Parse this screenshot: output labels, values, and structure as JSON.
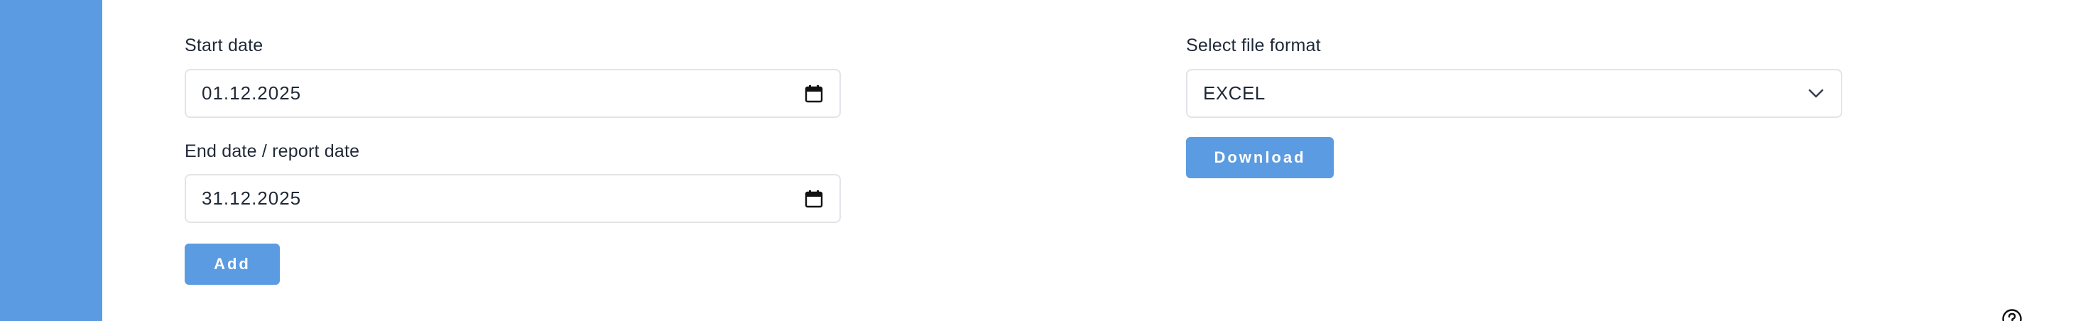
{
  "colors": {
    "sidebar": "#5b9be2",
    "primary_button": "#5b9be2",
    "input_border": "#e2e4e8",
    "text": "#1f2937"
  },
  "form": {
    "start_date": {
      "label": "Start date",
      "value": "01.12.2025",
      "icon": "calendar-icon"
    },
    "end_date": {
      "label": "End date / report date",
      "value": "31.12.2025",
      "icon": "calendar-icon"
    },
    "add_button": "Add"
  },
  "export": {
    "format_label": "Select file format",
    "format_value": "EXCEL",
    "format_icon": "chevron-down-icon",
    "download_button": "Download"
  },
  "help": {
    "icon": "help-icon"
  }
}
